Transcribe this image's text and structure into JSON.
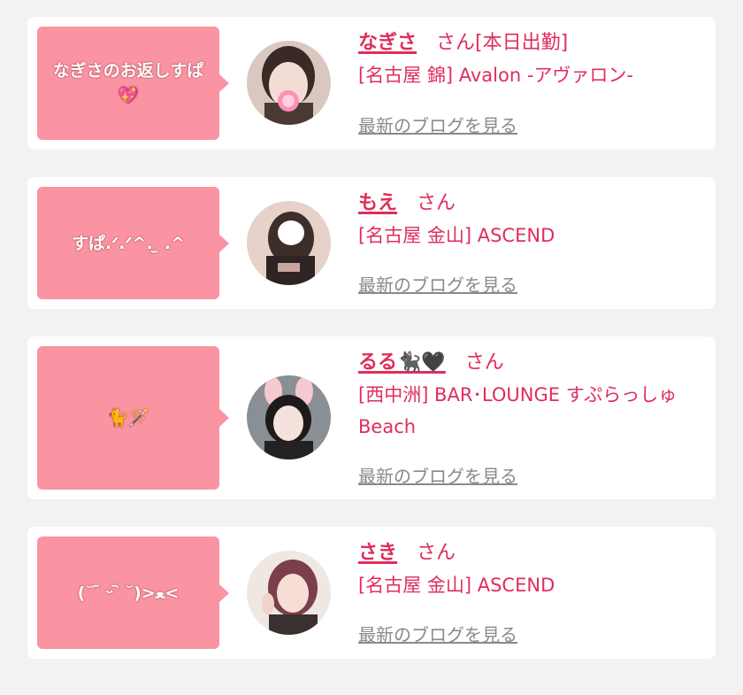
{
  "cards": [
    {
      "message": "なぎさのお返しすぱ💖",
      "name": "なぎさ",
      "suffix": "さん[本日出勤]",
      "shop": "[名古屋 錦] Avalon -アヴァロン-",
      "blog_link": "最新のブログを見る",
      "avatar_icon": "girl-photo-icon"
    },
    {
      "message": "すぱ.ᐟ.ᐟ^. ̫ .^",
      "name": "もえ",
      "suffix": "さん",
      "shop": "[名古屋 金山] ASCEND",
      "blog_link": "最新のブログを見る",
      "avatar_icon": "girl-photo-icon"
    },
    {
      "message": "🐈🪄",
      "name": "るる🐈‍⬛🖤",
      "suffix": "さん",
      "shop": "[西中洲] BAR･LOUNGE すぷらっしゅBeach",
      "blog_link": "最新のブログを見る",
      "avatar_icon": "girl-photo-icon"
    },
    {
      "message": "(˘ ᷇ ᵕ ᷆ ˘)>ﻌ<",
      "name": "さき",
      "suffix": "さん",
      "shop": "[名古屋 金山] ASCEND",
      "blog_link": "最新のブログを見る",
      "avatar_icon": "girl-photo-icon"
    }
  ],
  "colors": {
    "accent": "#e02d5d",
    "bubble": "#fa93a2",
    "link_gray": "#8a8a8a",
    "background": "#f2f2f2"
  }
}
